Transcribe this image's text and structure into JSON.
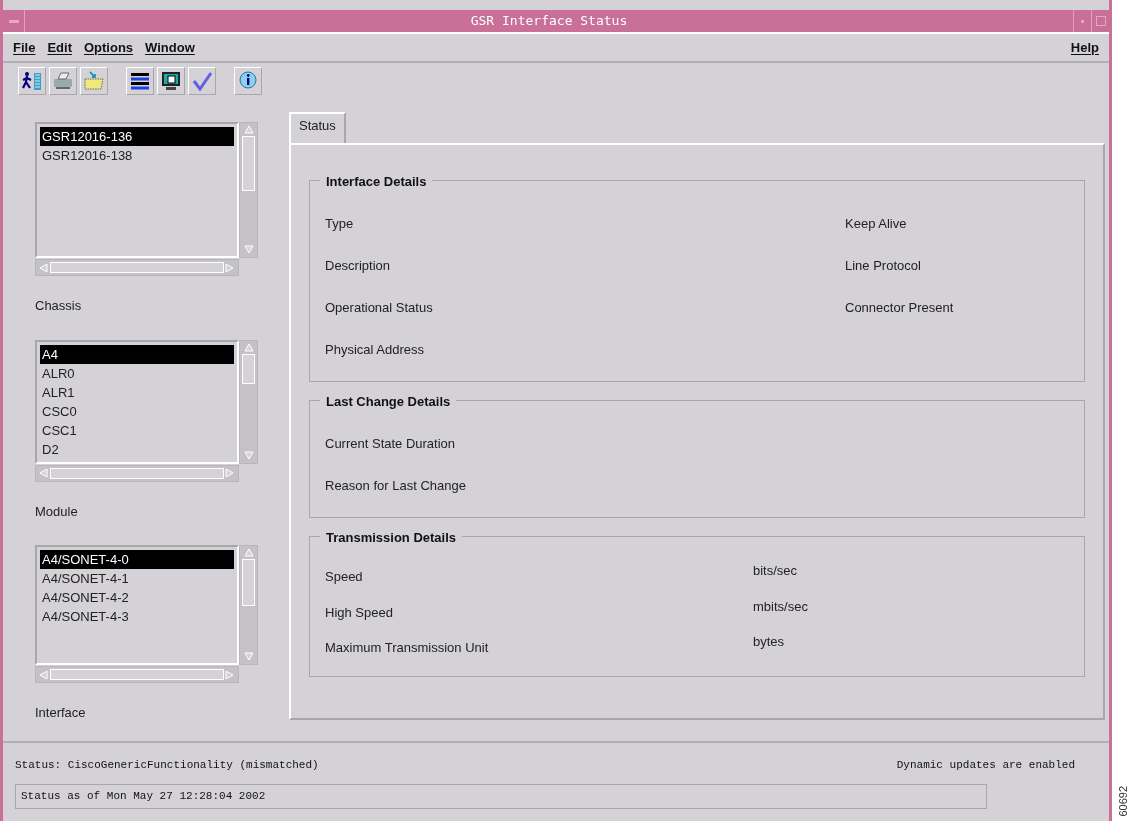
{
  "window": {
    "title": "GSR Interface Status"
  },
  "menu": {
    "left": [
      "File",
      "Edit",
      "Options",
      "Window"
    ],
    "right": [
      "Help"
    ]
  },
  "lists": [
    {
      "label": "Chassis",
      "items": [
        {
          "text": "GSR12016-136",
          "selected": true
        },
        {
          "text": "GSR12016-138",
          "selected": false
        }
      ]
    },
    {
      "label": "Module",
      "items": [
        {
          "text": "A4",
          "selected": true
        },
        {
          "text": "ALR0",
          "selected": false
        },
        {
          "text": "ALR1",
          "selected": false
        },
        {
          "text": "CSC0",
          "selected": false
        },
        {
          "text": "CSC1",
          "selected": false
        },
        {
          "text": "D2",
          "selected": false
        }
      ]
    },
    {
      "label": "Interface",
      "items": [
        {
          "text": "A4/SONET-4-0",
          "selected": true
        },
        {
          "text": "A4/SONET-4-1",
          "selected": false
        },
        {
          "text": "A4/SONET-4-2",
          "selected": false
        },
        {
          "text": "A4/SONET-4-3",
          "selected": false
        }
      ]
    }
  ],
  "tabs": [
    {
      "label": "Status",
      "selected": true
    }
  ],
  "groups": [
    {
      "title": "Interface Details",
      "kind": "labels",
      "rows": [
        {
          "label": "Type",
          "second": "Keep Alive"
        },
        {
          "label": "Description",
          "second": "Line Protocol"
        },
        {
          "label": "Operational Status",
          "second": "Connector Present"
        },
        {
          "label": "Physical Address"
        }
      ]
    },
    {
      "title": "Last Change Details",
      "kind": "labels",
      "rows": [
        {
          "label": "Current State Duration"
        },
        {
          "label": "Reason for Last Change"
        }
      ]
    },
    {
      "title": "Transmission Details",
      "kind": "units",
      "rows": [
        {
          "label": "Speed",
          "second": "bits/sec"
        },
        {
          "label": "High Speed",
          "second": "mbits/sec"
        },
        {
          "label": "Maximum Transmission Unit",
          "second": "bytes"
        }
      ]
    }
  ],
  "status": {
    "message": "Status: CiscoGenericFunctionality (mismatched)",
    "updates": "Dynamic updates are enabled",
    "field": "Status as of Mon May 27 12:28:04 2002"
  },
  "figure_id": "60692"
}
